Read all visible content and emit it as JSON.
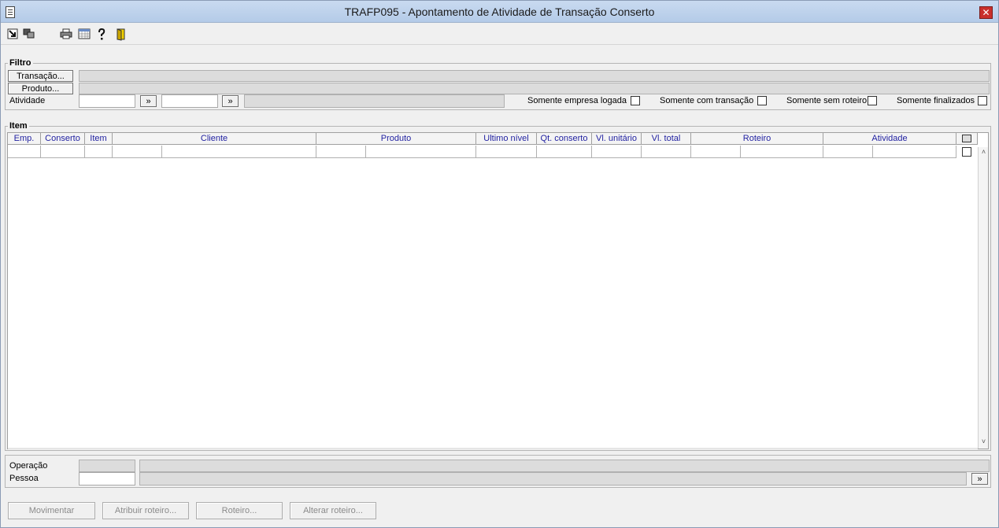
{
  "window": {
    "title": "TRAFP095 - Apontamento de Atividade de Transação Conserto",
    "close_glyph": "✕"
  },
  "toolbar": {
    "icons": [
      "arrow-in-icon",
      "windows-icon",
      "printer-icon",
      "calendar-icon",
      "help-icon",
      "exit-door-icon"
    ]
  },
  "filtro": {
    "title": "Filtro",
    "transacao_button": "Transação...",
    "produto_button": "Produto...",
    "atividade_label": "Atividade",
    "lookup_glyph": "»",
    "checkboxes": [
      {
        "label": "Somente empresa logada",
        "checked": false
      },
      {
        "label": "Somente com transação",
        "checked": false
      },
      {
        "label": "Somente sem roteiro",
        "checked": false
      },
      {
        "label": "Somente finalizados",
        "checked": false
      }
    ]
  },
  "item": {
    "title": "Item",
    "columns": [
      "Emp.",
      "Conserto",
      "Item",
      "Cliente",
      "Produto",
      "Ultimo nível",
      "Qt. conserto",
      "Vl. unitário",
      "Vl. total",
      "Roteiro",
      "Atividade"
    ]
  },
  "bottom": {
    "operacao_label": "Operação",
    "pessoa_label": "Pessoa",
    "lookup_glyph": "»"
  },
  "actions": {
    "movimentar": "Movimentar",
    "atribuir_roteiro": "Atribuir roteiro...",
    "roteiro": "Roteiro...",
    "alterar_roteiro": "Alterar roteiro..."
  },
  "colors": {
    "titlebar": "#b4cbe8",
    "header_text": "#1f1fa0",
    "close": "#c9302c"
  }
}
